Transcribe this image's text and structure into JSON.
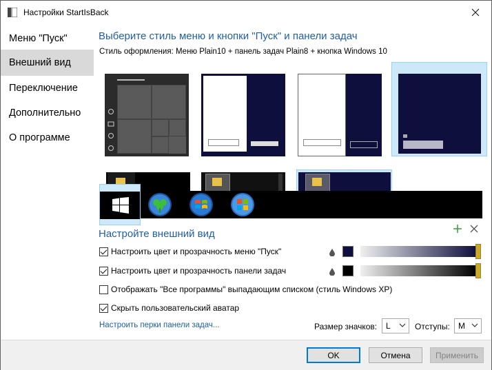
{
  "window": {
    "title": "Настройки StartIsBack"
  },
  "sidebar": {
    "items": [
      {
        "label": "Меню \"Пуск\""
      },
      {
        "label": "Внешний вид"
      },
      {
        "label": "Переключение"
      },
      {
        "label": "Дополнительно"
      },
      {
        "label": "О программе"
      }
    ],
    "selected_index": 1
  },
  "appearance": {
    "heading": "Выберите стиль меню и кнопки \"Пуск\" и панели задач",
    "style_label": "Стиль оформления:",
    "style_value": "Меню Plain10 + панель задач Plain8 + кнопка Windows 10"
  },
  "customize": {
    "heading": "Настройте внешний вид",
    "options": [
      {
        "label": "Настроить цвет и прозрачность меню \"Пуск\"",
        "checked": true
      },
      {
        "label": "Настроить цвет и прозрачность панели задач",
        "checked": true
      },
      {
        "label": "Отображать \"Все программы\" выпадающим списком (стиль Windows XP)",
        "checked": false
      },
      {
        "label": "Скрыть пользовательский аватар",
        "checked": true
      }
    ],
    "taskbar_link": "Настроить перки панели задач...",
    "icon_size_label": "Размер значков:",
    "icon_size_value": "L",
    "spacing_label": "Отступы:",
    "spacing_value": "M",
    "menu_color": "#0f0f3e",
    "taskbar_color": "#000000",
    "accent_color": "#c8a92b"
  },
  "buttons": {
    "ok": "OK",
    "cancel": "Отмена",
    "apply": "Применить"
  }
}
